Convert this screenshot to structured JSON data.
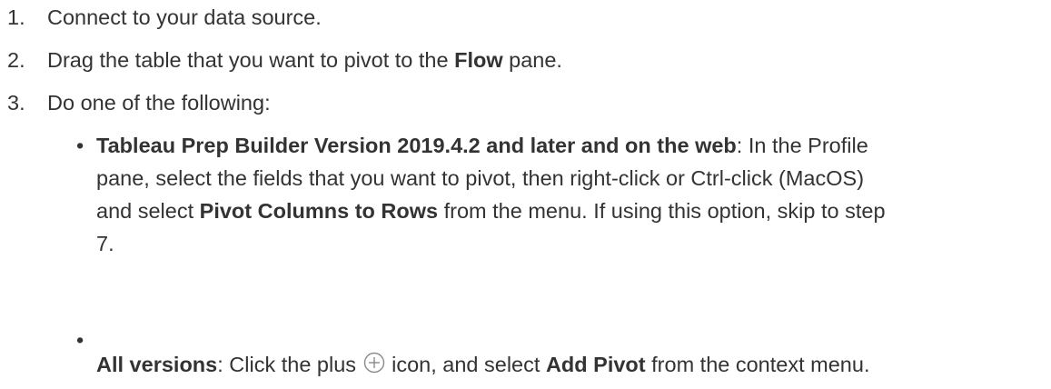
{
  "steps": [
    {
      "num": "1.",
      "text": "Connect to your data source."
    },
    {
      "num": "2.",
      "pre": "Drag the table that you want to pivot to the ",
      "bold": "Flow",
      "post": " pane."
    },
    {
      "num": "3.",
      "text": "Do one of the following:"
    }
  ],
  "bullets": [
    {
      "marker": "•",
      "bold": "Tableau Prep Builder Version 2019.4.2 and later and on the web",
      "line1_rest": ": In the Profile",
      "line2": "pane, select the fields that you want to pivot, then right-click or Ctrl-click (MacOS)",
      "line3_pre": "and select ",
      "line3_bold": "Pivot Columns to Rows",
      "line3_post": " from the menu. If using this option, skip to step",
      "line4": "7."
    },
    {
      "marker": "•",
      "bold": "All versions",
      "text_pre": ": Click the plus ",
      "icon": "plus-circle-icon",
      "text_mid": " icon, and select ",
      "bold2": "Add Pivot",
      "text_post": " from the context menu."
    }
  ],
  "colors": {
    "text": "#333333",
    "icon": "#8a8a8a"
  }
}
